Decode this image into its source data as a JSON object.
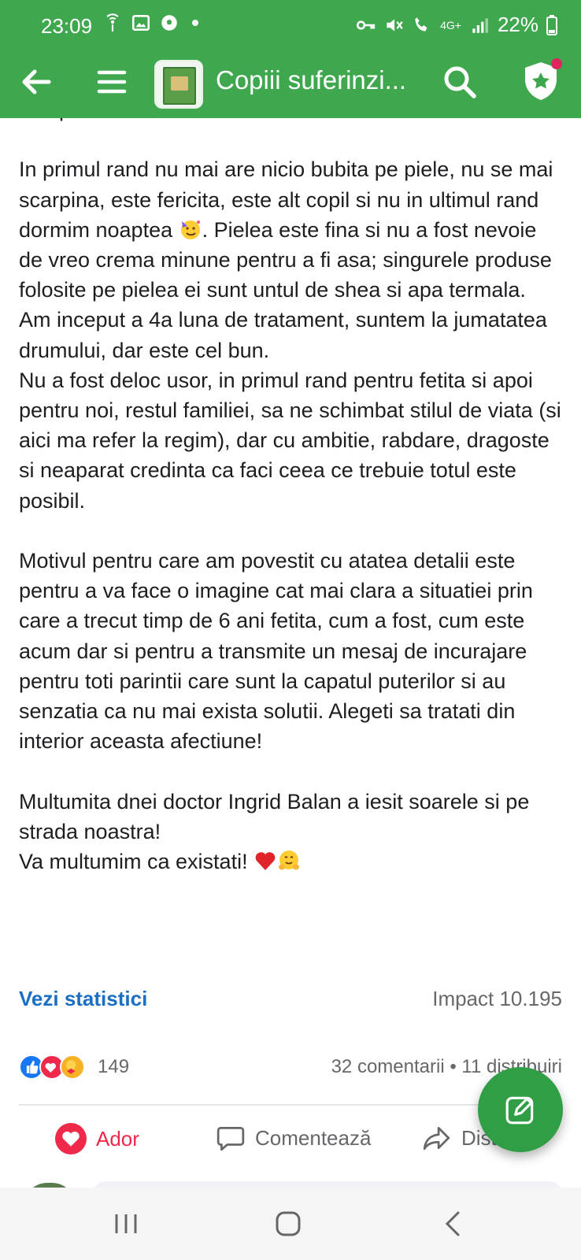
{
  "status_bar": {
    "time": "23:09",
    "battery": "22%",
    "network": "4G+"
  },
  "header": {
    "title": "Copiii suferinzi...",
    "icons": [
      "back-arrow-icon",
      "menu-icon",
      "search-icon",
      "shield-star-icon"
    ]
  },
  "post": {
    "clipped_line": "sa apara... Si sunt fantastice.",
    "paragraphs": [
      "In primul rand nu mai are nicio bubita pe piele, nu se mai scarpina, este fericita, este alt copil si nu in ultimul rand dormim noaptea",
      ". Pielea este fina si nu a fost nevoie de vreo crema minune pentru a fi asa; singurele produse folosite pe pielea ei sunt untul de shea si apa termala.",
      "Am inceput a 4a luna de tratament, suntem la jumatatea drumului, dar este cel bun.",
      "Nu a fost deloc usor, in primul rand pentru fetita si apoi pentru noi, restul familiei, sa ne schimbat stilul de viata (si aici ma refer la regim), dar cu ambitie, rabdare, dragoste si neaparat credinta ca faci ceea ce trebuie totul este posibil.",
      "Motivul pentru care am povestit cu atatea detalii este pentru a va face o imagine cat mai clara a situatiei prin care a trecut timp de 6 ani fetita, cum a fost, cum este acum dar si pentru a transmite un mesaj de incurajare pentru toti parintii care sunt la capatul puterilor si au senzatia ca nu mai exista solutii. Alegeti sa tratati din interior aceasta afectiune!",
      "Multumita dnei doctor Ingrid Balan a iesit soarele si pe strada noastra!",
      "Va multumim ca existati!"
    ]
  },
  "stats": {
    "vezi_statistici": "Vezi statistici",
    "impact": "Impact 10.195"
  },
  "reactions": {
    "count": "149",
    "comments_shares": "32 comentarii • 11 distribuiri"
  },
  "actions": {
    "ador": "Ador",
    "comment": "Comentează",
    "share": "Distribuie"
  },
  "colors": {
    "header_green": "#3fa84f",
    "fab_green": "#2f9e44",
    "link_blue": "#1a6fc4",
    "love_red": "#f02849"
  }
}
